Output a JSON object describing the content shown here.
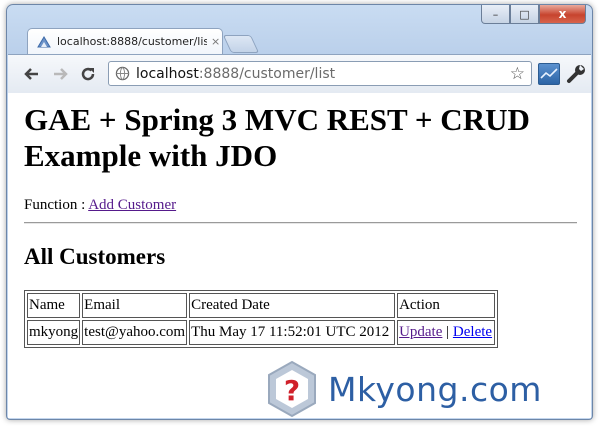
{
  "browser": {
    "tab_title": "localhost:8888/customer/list",
    "tab_close": "×",
    "url_host": "localhost",
    "url_path": ":8888/customer/list",
    "window_minimize": "–",
    "window_maximize": "□",
    "window_close": "x"
  },
  "page": {
    "heading": "GAE + Spring 3 MVC REST + CRUD Example with JDO",
    "function_label": "Function : ",
    "add_customer_link": "Add Customer",
    "section_title": "All Customers",
    "table": {
      "headers": [
        "Name",
        "Email",
        "Created Date",
        "Action"
      ],
      "rows": [
        {
          "name": "mkyong",
          "email": "test@yahoo.com",
          "created": "Thu May 17 11:52:01 UTC 2012",
          "update_link": "Update",
          "separator": " | ",
          "delete_link": "Delete"
        }
      ]
    }
  },
  "watermark": {
    "logo": "?",
    "text": "Mkyong.com"
  },
  "colors": {
    "visited_link": "#551a8b",
    "unvisited_link": "#0000ee",
    "watermark_blue": "#2d5fa4"
  }
}
